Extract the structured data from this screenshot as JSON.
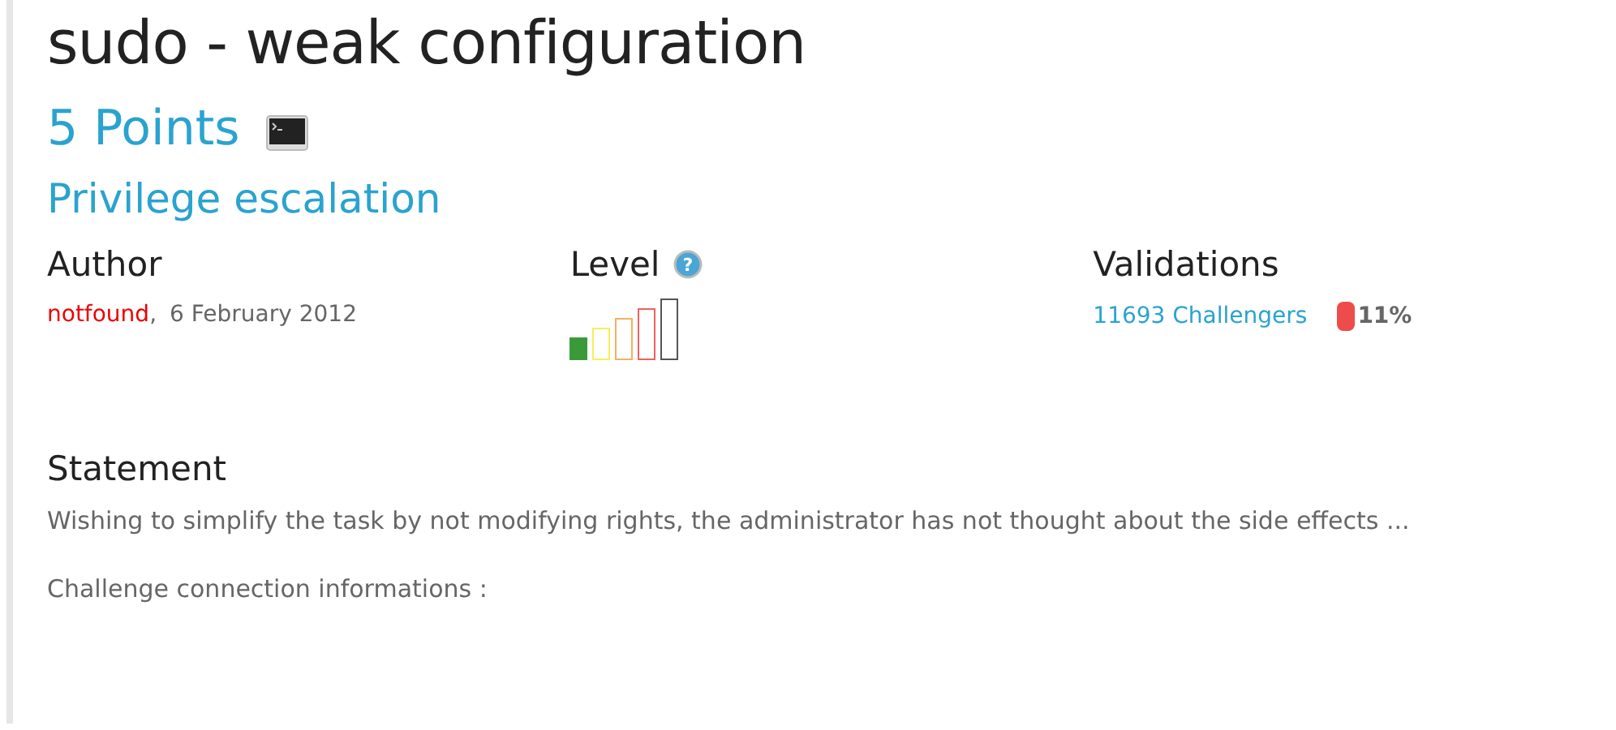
{
  "title": "sudo - weak configuration",
  "points": "5 Points",
  "category": "Privilege escalation",
  "author": {
    "label": "Author",
    "name": "notfound",
    "separator": ",",
    "date": "6 February 2012"
  },
  "level": {
    "label": "Level",
    "help": "?",
    "bars": [
      {
        "color": "#3a9a3a",
        "filled": true
      },
      {
        "color": "#f5f05a",
        "filled": false
      },
      {
        "color": "#f5b062",
        "filled": false
      },
      {
        "color": "#f06060",
        "filled": false
      },
      {
        "color": "#555555",
        "filled": false
      }
    ]
  },
  "validations": {
    "label": "Validations",
    "challengers": "11693 Challengers",
    "percent": "11%"
  },
  "statement": {
    "heading": "Statement",
    "text": "Wishing to simplify the task by not modifying rights, the administrator has not thought about the side effects ...",
    "connection": "Challenge connection informations :"
  }
}
